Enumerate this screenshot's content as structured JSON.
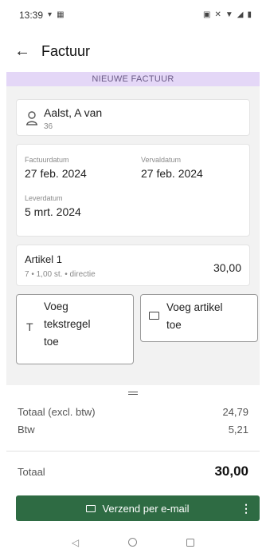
{
  "status_bar": {
    "time": "13:39"
  },
  "header": {
    "title": "Factuur"
  },
  "banner": {
    "text": "NIEUWE FACTUUR"
  },
  "customer": {
    "name": "Aalst, A van",
    "number": "36"
  },
  "dates": {
    "invoice_date_label": "Factuurdatum",
    "invoice_date": "27 feb. 2024",
    "due_date_label": "Vervaldatum",
    "due_date": "27 feb. 2024",
    "delivery_date_label": "Leverdatum",
    "delivery_date": "5 mrt. 2024"
  },
  "article": {
    "name": "Artikel 1",
    "details": "7 • 1,00 st. • directie",
    "amount": "30,00"
  },
  "actions": {
    "add_text_line_label": [
      "Voeg",
      "tekstregel",
      "toe"
    ],
    "add_article_label": [
      "Voeg artikel",
      "toe"
    ]
  },
  "totals": {
    "subtotal_label": "Totaal (excl. btw)",
    "subtotal_value": "24,79",
    "vat_label": "Btw",
    "vat_value": "5,21",
    "total_label": "Totaal",
    "total_value": "30,00"
  },
  "send_button": {
    "label": "Verzend per e-mail"
  },
  "colors": {
    "banner_bg": "#e4d7f7",
    "primary": "#2e6b43"
  }
}
